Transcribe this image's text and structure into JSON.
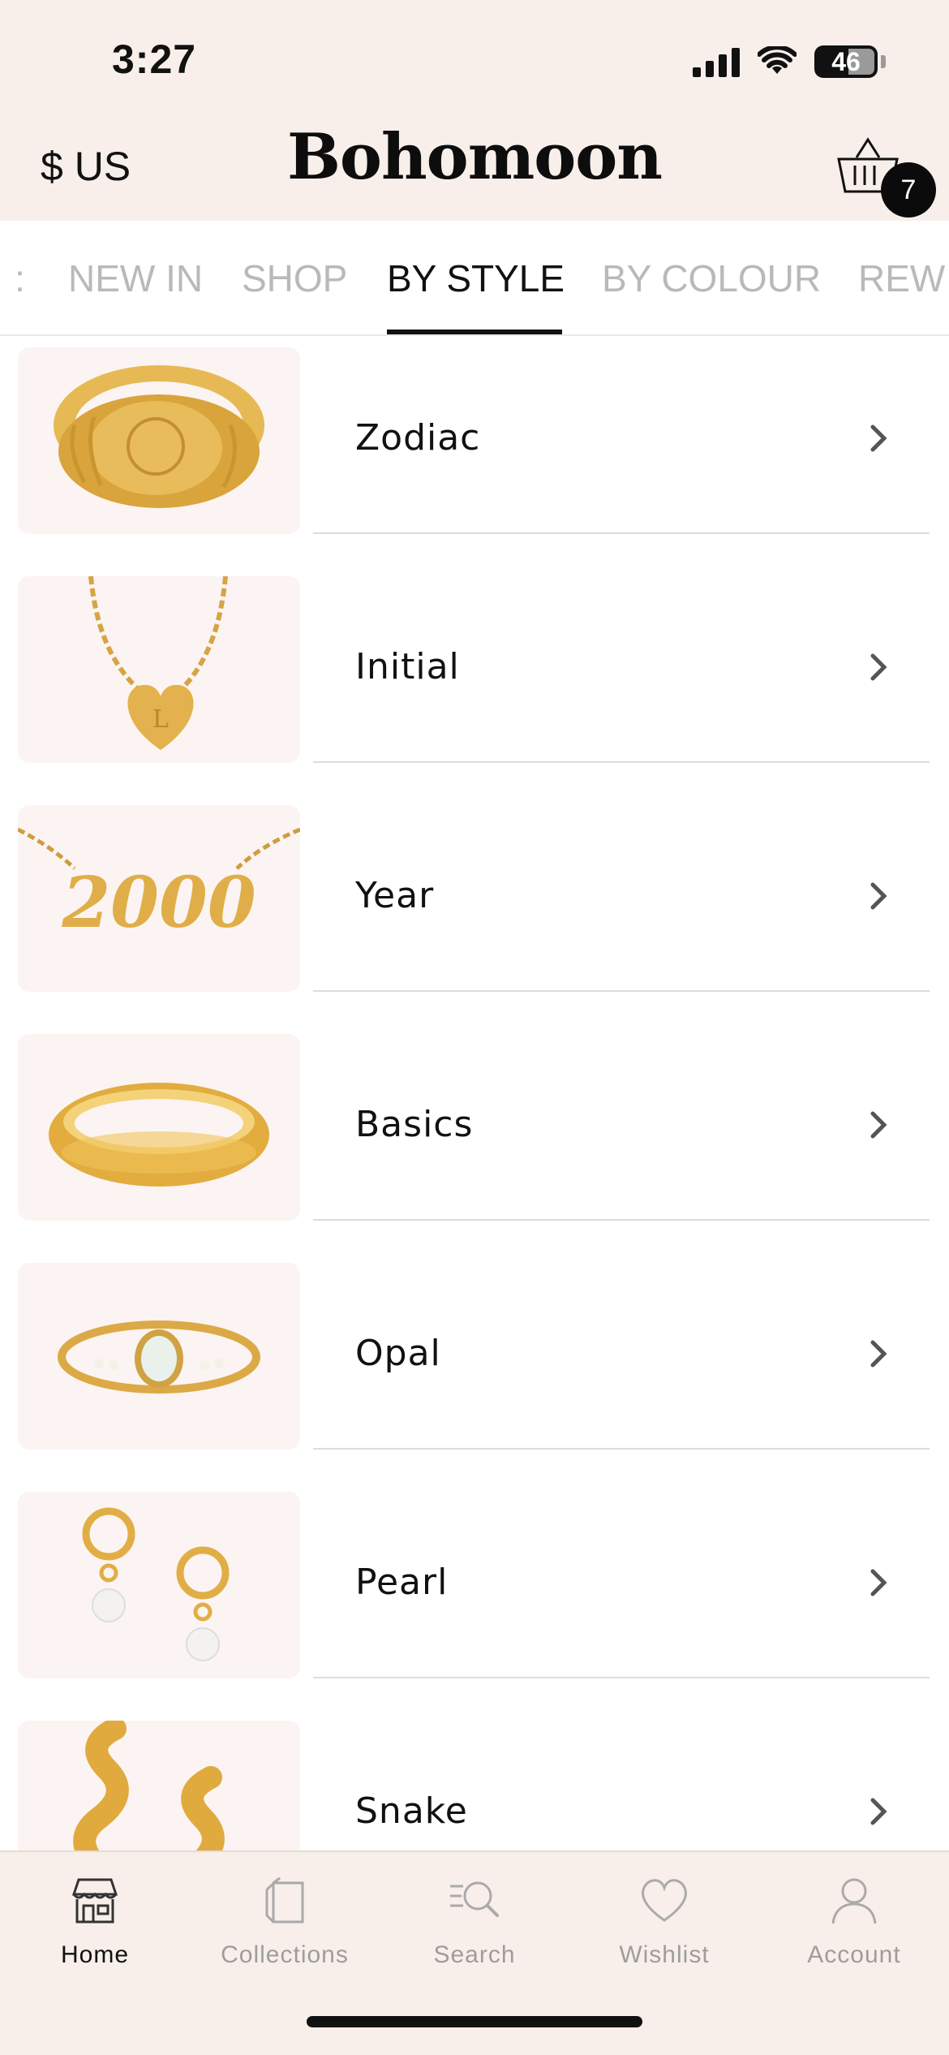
{
  "status_bar": {
    "time": "3:27",
    "battery": "46"
  },
  "header": {
    "currency": "$ US",
    "brand": "Bohomoon",
    "cart_count": "7"
  },
  "tabs": {
    "stub": ":",
    "items": [
      "NEW IN",
      "SHOP",
      "BY STYLE",
      "BY COLOUR",
      "REW"
    ],
    "active": "BY STYLE"
  },
  "styles": [
    {
      "label": "Zodiac",
      "icon": "signet-ring"
    },
    {
      "label": "Initial",
      "icon": "heart-necklace"
    },
    {
      "label": "Year",
      "icon": "year-necklace"
    },
    {
      "label": "Basics",
      "icon": "band-ring"
    },
    {
      "label": "Opal",
      "icon": "opal-ring"
    },
    {
      "label": "Pearl",
      "icon": "pearl-earrings"
    },
    {
      "label": "Snake",
      "icon": "snake-earrings"
    }
  ],
  "bottom_nav": [
    {
      "label": "Home",
      "icon": "store-icon"
    },
    {
      "label": "Collections",
      "icon": "collections-icon"
    },
    {
      "label": "Search",
      "icon": "search-icon"
    },
    {
      "label": "Wishlist",
      "icon": "heart-icon"
    },
    {
      "label": "Account",
      "icon": "user-icon"
    }
  ],
  "colors": {
    "header_bg": "#f8efea",
    "gold": "#e2b24a",
    "active": "#111111",
    "inactive": "#b9b9b9"
  }
}
